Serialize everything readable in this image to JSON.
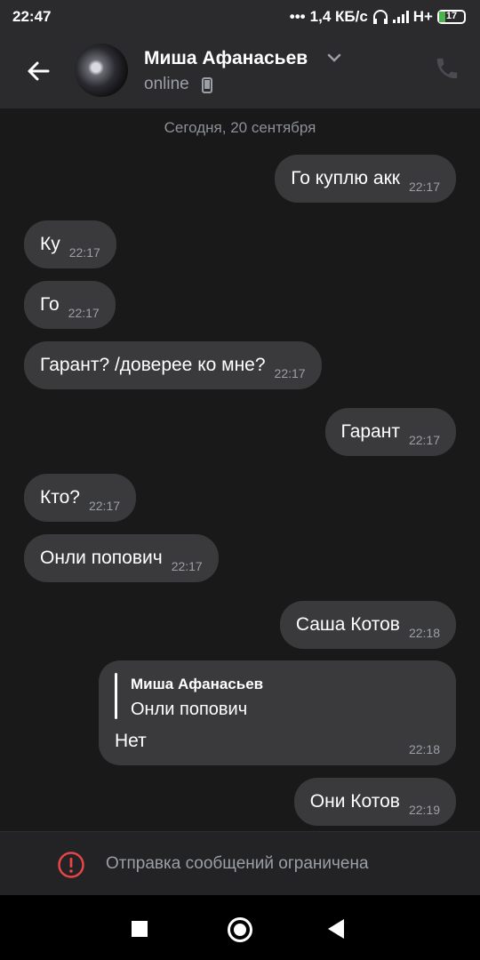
{
  "statusbar": {
    "time": "22:47",
    "network_speed": "1,4 КБ/с",
    "network_type": "H+",
    "battery": "17"
  },
  "header": {
    "contact_name": "Миша Афанасьев",
    "status": "online",
    "icons": [
      "back-arrow-icon",
      "chevron-down-icon",
      "mobile-icon",
      "phone-icon"
    ]
  },
  "chat": {
    "date": "Сегодня, 20 сентября",
    "messages": [
      {
        "text": "Го куплю акк",
        "time": "22:17",
        "side": "out"
      },
      {
        "text": "Ку",
        "time": "22:17",
        "side": "in"
      },
      {
        "text": "Го",
        "time": "22:17",
        "side": "in"
      },
      {
        "text": "Гарант? /доверее ко мне?",
        "time": "22:17",
        "side": "in"
      },
      {
        "text": "Гарант",
        "time": "22:17",
        "side": "out"
      },
      {
        "text": "Кто?",
        "time": "22:17",
        "side": "in"
      },
      {
        "text": "Онли попович",
        "time": "22:17",
        "side": "in"
      },
      {
        "text": "Саша Котов",
        "time": "22:18",
        "side": "out"
      },
      {
        "text": "Они Котов",
        "time": "22:19",
        "side": "out"
      }
    ],
    "reply_message": {
      "quoted_name": "Миша Афанасьев",
      "quoted_text": "Онли попович",
      "text": "Нет",
      "time": "22:18"
    }
  },
  "restricted": {
    "text": "Отправка сообщений ограничена",
    "icon": "alert-circle-icon",
    "icon_color": "#e64646"
  },
  "navbar": {
    "icons": [
      "recent-apps-icon",
      "home-icon",
      "back-icon"
    ]
  }
}
